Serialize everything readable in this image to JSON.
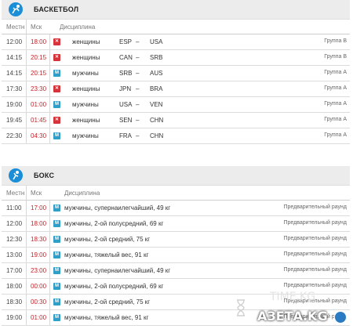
{
  "basketball": {
    "title": "БАСКЕТБОЛ",
    "columns": [
      "Местн",
      "Мск",
      "Дисциплина"
    ],
    "rows": [
      {
        "local": "12:00",
        "msk": "18:00",
        "gender": "w",
        "discipline": "женщины",
        "team1": "ESP",
        "sep": "–",
        "team2": "USA",
        "note": "Группа B"
      },
      {
        "local": "14:15",
        "msk": "20:15",
        "gender": "w",
        "discipline": "женщины",
        "team1": "CAN",
        "sep": "–",
        "team2": "SRB",
        "note": "Группа B"
      },
      {
        "local": "14:15",
        "msk": "20:15",
        "gender": "m",
        "discipline": "мужчины",
        "team1": "SRB",
        "sep": "–",
        "team2": "AUS",
        "note": "Группа A"
      },
      {
        "local": "17:30",
        "msk": "23:30",
        "gender": "w",
        "discipline": "женщины",
        "team1": "JPN",
        "sep": "–",
        "team2": "BRA",
        "note": "Группа A"
      },
      {
        "local": "19:00",
        "msk": "01:00",
        "gender": "m",
        "discipline": "мужчины",
        "team1": "USA",
        "sep": "–",
        "team2": "VEN",
        "note": "Группа A"
      },
      {
        "local": "19:45",
        "msk": "01:45",
        "gender": "w",
        "discipline": "женщины",
        "team1": "SEN",
        "sep": "–",
        "team2": "CHN",
        "note": "Группа A"
      },
      {
        "local": "22:30",
        "msk": "04:30",
        "gender": "m",
        "discipline": "мужчины",
        "team1": "FRA",
        "sep": "–",
        "team2": "CHN",
        "note": "Группа A"
      }
    ]
  },
  "boxing": {
    "title": "БОКС",
    "columns": [
      "Местн",
      "Мск",
      "Дисциплина"
    ],
    "rows": [
      {
        "local": "11:00",
        "msk": "17:00",
        "gender": "m",
        "discipline": "мужчины, супернаилегчайший, 49 кг",
        "note": "Предварительный раунд"
      },
      {
        "local": "12:00",
        "msk": "18:00",
        "gender": "m",
        "discipline": "мужчины, 2-ой полусредний, 69 кг",
        "note": "Предварительный раунд"
      },
      {
        "local": "12:30",
        "msk": "18:30",
        "gender": "m",
        "discipline": "мужчины, 2-ой средний, 75 кг",
        "note": "Предварительный раунд"
      },
      {
        "local": "13:00",
        "msk": "19:00",
        "gender": "m",
        "discipline": "мужчины, тяжелый вес, 91 кг",
        "note": "Предварительный раунд"
      },
      {
        "local": "17:00",
        "msk": "23:00",
        "gender": "m",
        "discipline": "мужчины, супернаилегчайший, 49 кг",
        "note": "Предварительный раунд"
      },
      {
        "local": "18:00",
        "msk": "00:00",
        "gender": "m",
        "discipline": "мужчины, 2-ой полусредний, 69 кг",
        "note": "Предварительный раунд"
      },
      {
        "local": "18:30",
        "msk": "00:30",
        "gender": "m",
        "discipline": "мужчины, 2-ой средний, 75 кг",
        "note": "Предварительный раунд"
      },
      {
        "local": "19:00",
        "msk": "01:00",
        "gender": "m",
        "discipline": "мужчины, тяжелый вес, 91 кг",
        "note": "Предварительный раунд"
      }
    ]
  },
  "badges": {
    "w": "✕",
    "m": "M"
  },
  "watermark": {
    "text": "АЗЕТА.KG",
    "ghost": "TIME.KG"
  },
  "colors": {
    "accent": "#1a8ed6",
    "msk_time": "#c0262d",
    "women_badge": "#d6343b",
    "men_badge": "#2f9fc8"
  },
  "icons": [
    "basketball-icon",
    "boxing-icon"
  ]
}
